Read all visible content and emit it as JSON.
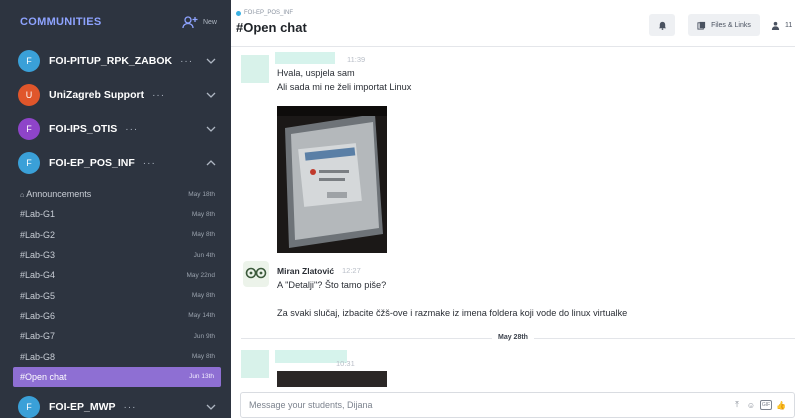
{
  "sidebar": {
    "title": "COMMUNITIES",
    "new_label": "New",
    "communities_top": [
      {
        "initial": "F",
        "name": "FOI-PITUP_RPK_ZABOK",
        "color": "#3aa0d8"
      },
      {
        "initial": "U",
        "name": "UniZagreb Support",
        "color": "#e0562b"
      },
      {
        "initial": "F",
        "name": "FOI-IPS_OTIS",
        "color": "#8e44c9"
      },
      {
        "initial": "F",
        "name": "FOI-EP_POS_INF",
        "color": "#3aa0d8"
      }
    ],
    "channels": [
      {
        "name": "Announcements",
        "date": "May 18th"
      },
      {
        "name": "#Lab-G1",
        "date": "May 8th"
      },
      {
        "name": "#Lab-G2",
        "date": "May 8th"
      },
      {
        "name": "#Lab-G3",
        "date": "Jun 4th"
      },
      {
        "name": "#Lab-G4",
        "date": "May 22nd"
      },
      {
        "name": "#Lab-G5",
        "date": "May 8th"
      },
      {
        "name": "#Lab-G6",
        "date": "May 14th"
      },
      {
        "name": "#Lab-G7",
        "date": "Jun 9th"
      },
      {
        "name": "#Lab-G8",
        "date": "May 8th"
      },
      {
        "name": "#Open chat",
        "date": "Jun 13th"
      }
    ],
    "community_bottom": {
      "initial": "F",
      "name": "FOI-EP_MWP",
      "color": "#3aa0d8"
    }
  },
  "header": {
    "crumb": "FOI-EP_POS_INF",
    "title": "#Open chat",
    "files_links_label": "Files & Links",
    "members_count": "11"
  },
  "feed": {
    "msg1": {
      "time": "11:39",
      "line1": "Hvala, uspjela sam",
      "line2": "Ali sada mi ne želi importat Linux"
    },
    "msg2": {
      "user": "Miran Zlatović",
      "time": "12:27",
      "line1": "A \"Detalji\"? Što tamo piše?",
      "line2": "Za svaki slučaj, izbacite čžš-ove i razmake iz imena foldera koji vode do linux virtualke"
    },
    "date_divider": "May 28th",
    "msg3": {
      "time": "10:31"
    }
  },
  "composer": {
    "placeholder": "Message your students, Dijana"
  }
}
